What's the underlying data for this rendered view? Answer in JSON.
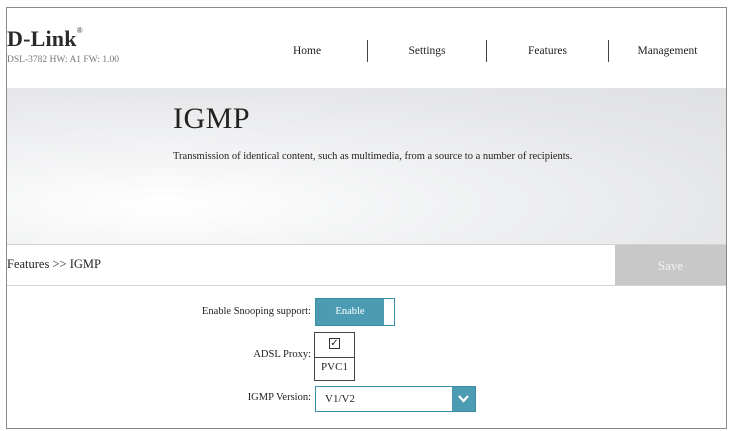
{
  "header": {
    "logo_text": "D-Link",
    "model_info": "DSL-3782  HW: A1  FW: 1.00",
    "nav": [
      "Home",
      "Settings",
      "Features",
      "Management"
    ]
  },
  "banner": {
    "title": "IGMP",
    "description": "Transmission of identical content, such as multimedia, from a source to a number of recipients."
  },
  "breadcrumb": "Features >> IGMP",
  "save_label": "Save",
  "form": {
    "snooping": {
      "label": "Enable Snooping support:",
      "value": "Enable",
      "enabled": true
    },
    "adsl_proxy": {
      "label": "ADSL Proxy:",
      "checked": true,
      "pvc": "PVC1"
    },
    "igmp_version": {
      "label": "IGMP Version:",
      "value": "V1/V2"
    }
  },
  "colors": {
    "accent": "#4b9cb3",
    "save_disabled": "#c8c8c8"
  },
  "icons": {
    "check": "checkmark-icon",
    "dropdown": "chevron-down-icon"
  }
}
